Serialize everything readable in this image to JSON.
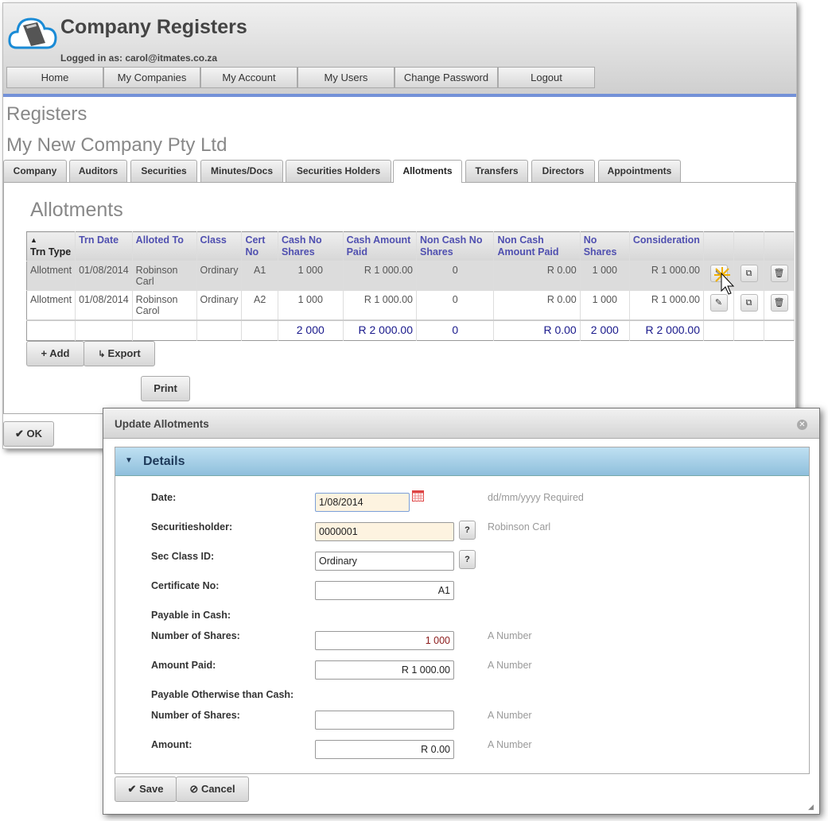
{
  "app": {
    "title": "Company Registers",
    "logged_in": "Logged in as: carol@itmates.co.za"
  },
  "nav": [
    "Home",
    "My Companies",
    "My Account",
    "My Users",
    "Change Password",
    "Logout"
  ],
  "page": {
    "heading": "Registers",
    "company": "My New Company Pty Ltd",
    "section": "Allotments"
  },
  "tabs": [
    "Company",
    "Auditors",
    "Securities",
    "Minutes/Docs",
    "Securities Holders",
    "Allotments",
    "Transfers",
    "Directors",
    "Appointments"
  ],
  "active_tab": "Allotments",
  "table": {
    "headers": [
      "Trn Type",
      "Trn Date",
      "Alloted To",
      "Class",
      "Cert No",
      "Cash No Shares",
      "Cash Amount Paid",
      "Non Cash No Shares",
      "Non Cash Amount Paid",
      "No Shares",
      "Consideration"
    ],
    "sort_indicator": "▲",
    "rows": [
      [
        "Allotment",
        "01/08/2014",
        "Robinson Carl",
        "Ordinary",
        "A1",
        "1 000",
        "R 1 000.00",
        "0",
        "R 0.00",
        "1 000",
        "R 1 000.00"
      ],
      [
        "Allotment",
        "01/08/2014",
        "Robinson Carol",
        "Ordinary",
        "A2",
        "1 000",
        "R 1 000.00",
        "0",
        "R 0.00",
        "1 000",
        "R 1 000.00"
      ]
    ],
    "totals": [
      "",
      "",
      "",
      "",
      "",
      "2 000",
      "R 2 000.00",
      "0",
      "R 0.00",
      "2 000",
      "R 2 000.00"
    ],
    "row_actions": [
      "edit-icon",
      "copy-icon",
      "delete-icon"
    ]
  },
  "buttons": {
    "add": "Add",
    "export": "Export",
    "print": "Print",
    "ok": "OK"
  },
  "dialog": {
    "title": "Update Allotments",
    "section": "Details",
    "fields": {
      "date": {
        "label": "Date:",
        "value": "1/08/2014",
        "hint": "dd/mm/yyyy Required"
      },
      "holder": {
        "label": "Securitiesholder:",
        "value": "0000001",
        "hint": "Robinson Carl"
      },
      "class": {
        "label": "Sec Class ID:",
        "value": "Ordinary"
      },
      "cert": {
        "label": "Certificate No:",
        "value": "A1"
      },
      "cash_heading": "Payable in Cash:",
      "cash_shares": {
        "label": "Number of Shares:",
        "value": "1 000",
        "hint": "A Number"
      },
      "cash_amount": {
        "label": "Amount Paid:",
        "value": "R 1 000.00",
        "hint": "A Number"
      },
      "noncash_heading": "Payable Otherwise than Cash:",
      "noncash_shares": {
        "label": "Number of Shares:",
        "value": "",
        "hint": "A Number"
      },
      "noncash_amount": {
        "label": "Amount:",
        "value": "R 0.00",
        "hint": "A Number"
      }
    },
    "help_button": "?",
    "save": "Save",
    "cancel": "Cancel"
  },
  "colors": {
    "accent": "#7391d8",
    "header_text": "#5050b0",
    "totals": "#1a1a8c",
    "details_bar": "#a8d0e8"
  }
}
